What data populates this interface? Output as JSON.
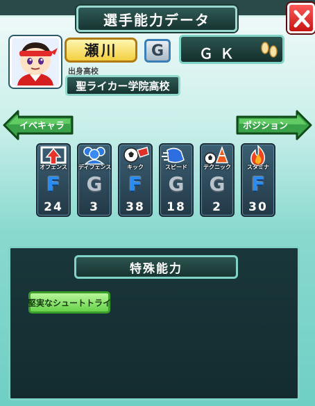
{
  "header": {
    "title": "選手能力データ",
    "close_icon": "close-x-icon"
  },
  "player": {
    "name": "瀬川",
    "grade": "G",
    "position": "ＧＫ",
    "position_icon": "footprints-icon",
    "school_label": "出身高校",
    "school": "聖ライカー学院高校"
  },
  "nav": {
    "left_label": "イベキャラ",
    "right_label": "ポジション"
  },
  "stats": [
    {
      "label": "オフェンス",
      "icon": "offense-arrow-icon",
      "grade": "F",
      "value": "24"
    },
    {
      "label": "ディフェンス",
      "icon": "defense-players-icon",
      "grade": "G",
      "value": "3"
    },
    {
      "label": "キック",
      "icon": "kick-ball-icon",
      "grade": "F",
      "value": "38"
    },
    {
      "label": "スピード",
      "icon": "speed-shoe-icon",
      "grade": "G",
      "value": "18"
    },
    {
      "label": "テクニック",
      "icon": "technique-cone-icon",
      "grade": "G",
      "value": "2"
    },
    {
      "label": "スタミナ",
      "icon": "stamina-flame-icon",
      "grade": "F",
      "value": "30"
    }
  ],
  "special": {
    "title": "特殊能力",
    "abilities": [
      "堅実なシュートトライ"
    ]
  },
  "colors": {
    "frame_top": "#eef9f8",
    "frame_bottom": "#6fcfc5",
    "grade_f": "#2a8cf0",
    "grade_g": "#b8c3cc",
    "ability_green": "#66d24a",
    "name_gold": "#f3cf40",
    "close_red": "#c51414"
  }
}
